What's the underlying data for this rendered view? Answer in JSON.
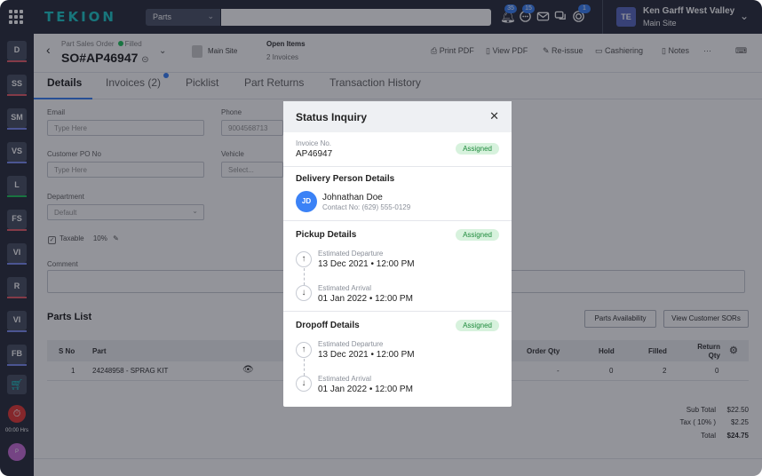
{
  "topbar": {
    "logo": "TEKION",
    "search_type": "Parts",
    "search_placeholder": "",
    "notifications": [
      {
        "icon": "bell-icon",
        "count": "35"
      },
      {
        "icon": "chat-icon",
        "count": "15"
      },
      {
        "icon": "mail-icon",
        "count": ""
      },
      {
        "icon": "chat-bubbles-icon",
        "count": ""
      },
      {
        "icon": "layers-icon",
        "count": "1"
      }
    ],
    "dealer_initials": "TE",
    "dealer_name": "Ken Garff West Valley F...",
    "dealer_site": "Main Site"
  },
  "rail": {
    "items": [
      {
        "label": "D",
        "color": "#e35d6a"
      },
      {
        "label": "SS",
        "color": "#e35d6a"
      },
      {
        "label": "SM",
        "color": "#7c8cf0"
      },
      {
        "label": "VS",
        "color": "#7c8cf0"
      },
      {
        "label": "L",
        "color": "#22c55e"
      },
      {
        "label": "FS",
        "color": "#e35d6a"
      },
      {
        "label": "VI",
        "color": "#7c8cf0"
      },
      {
        "label": "R",
        "color": "#e35d6a"
      },
      {
        "label": "VI",
        "color": "#7c8cf0"
      },
      {
        "label": "FB",
        "color": "#7c8cf0"
      }
    ],
    "timer": "00:00 Hrs",
    "user_initial": "P"
  },
  "header": {
    "subtitle": "Part Sales Order",
    "status": "Filled",
    "order_no": "SO#AP46947",
    "site": "Main Site",
    "open_items": "Open Items",
    "open_invoices": "2 Invoices",
    "actions": [
      "Print PDF",
      "View PDF",
      "Re-issue",
      "Cashiering",
      "Notes"
    ]
  },
  "tabs": [
    "Details",
    "Invoices (2)",
    "Picklist",
    "Part Returns",
    "Transaction History"
  ],
  "form": {
    "email_label": "Email",
    "email_placeholder": "Type Here",
    "phone_label": "Phone",
    "phone_value": "9004568713",
    "po_label": "Customer PO No",
    "po_placeholder": "Type Here",
    "vehicle_label": "Vehicle",
    "vehicle_placeholder": "Select...",
    "department_label": "Department",
    "department_value": "Default",
    "taxable_label": "Taxable",
    "taxable_rate": "10%",
    "comment_label": "Comment"
  },
  "parts": {
    "title": "Parts List",
    "availability_btn": "Parts Availability",
    "sors_btn": "View Customer SORs",
    "columns": [
      "S No",
      "Part",
      "Order Qty",
      "Hold",
      "Filled",
      "Return Qty"
    ],
    "rows": [
      {
        "sno": "1",
        "part": "24248958 - SPRAG KIT",
        "order_qty": "-",
        "hold": "0",
        "filled": "2",
        "return_qty": "0"
      }
    ],
    "subtotal_label": "Sub Total",
    "subtotal_value": "$22.50",
    "tax_label": "Tax ( 10% )",
    "tax_value": "$2.25",
    "total_label": "Total",
    "total_value": "$24.75"
  },
  "modal": {
    "title": "Status Inquiry",
    "invoice_label": "Invoice No.",
    "invoice_value": "AP46947",
    "invoice_status": "Assigned",
    "delivery_title": "Delivery Person Details",
    "person_initials": "JD",
    "person_name": "Johnathan Doe",
    "person_contact": "Contact No: (629) 555-0129",
    "pickup_title": "Pickup Details",
    "pickup_status": "Assigned",
    "pickup_departure_label": "Estimated Departure",
    "pickup_departure": "13 Dec 2021 • 12:00 PM",
    "pickup_arrival_label": "Estimated Arrival",
    "pickup_arrival": "01 Jan 2022 • 12:00 PM",
    "dropoff_title": "Dropoff Details",
    "dropoff_status": "Assigned",
    "dropoff_departure_label": "Estimated Departure",
    "dropoff_departure": "13 Dec 2021 • 12:00 PM",
    "dropoff_arrival_label": "Estimated Arrival",
    "dropoff_arrival": "01 Jan 2022 • 12:00 PM"
  },
  "colors": {
    "accent": "#3b82f6",
    "brand": "#1fc9c8",
    "success_bg": "#d7f2dd",
    "success_text": "#1e8a3c",
    "topbar": "#2a2f3d"
  }
}
